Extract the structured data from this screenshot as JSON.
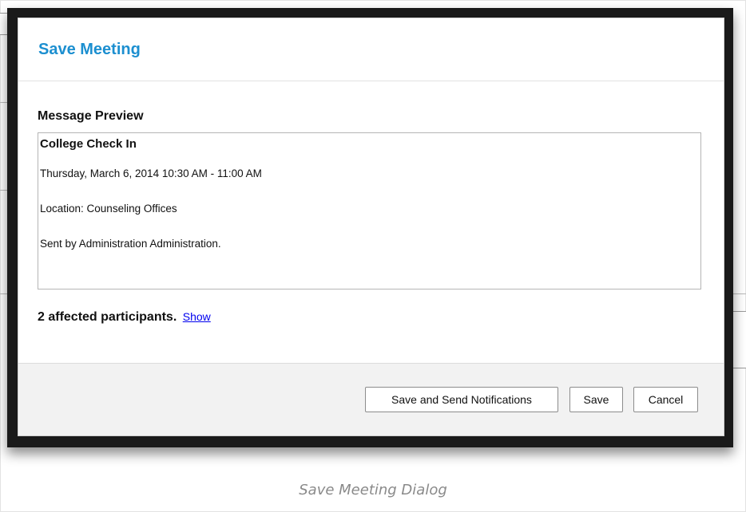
{
  "dialog": {
    "title": "Save Meeting",
    "section_label": "Message Preview",
    "preview": {
      "subject": "College Check In",
      "lines": [
        "Thursday, March 6, 2014 10:30 AM - 11:00 AM",
        "Location: Counseling Offices",
        "Sent by Administration Administration."
      ]
    },
    "affected": {
      "count_text": "2 affected participants.",
      "show_link": "Show"
    },
    "buttons": {
      "send": "Save and Send Notifications",
      "save": "Save",
      "cancel": "Cancel"
    }
  },
  "caption": "Save Meeting Dialog",
  "colors": {
    "title": "#1c8fd0",
    "link": "#0000ee",
    "footer_bg": "#f2f2f2",
    "overlay_border": "#1a1a1a"
  }
}
